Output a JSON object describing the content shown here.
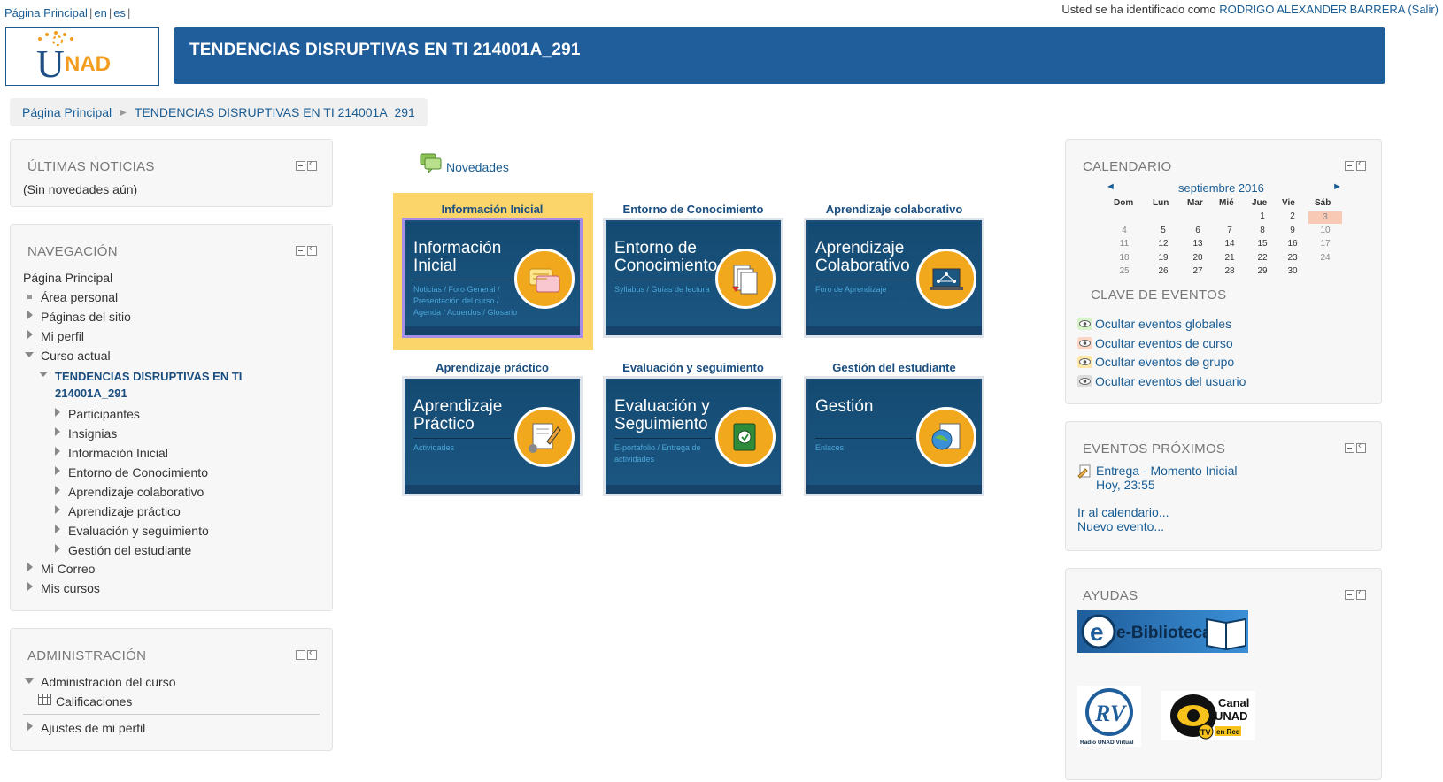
{
  "top_nav": {
    "home": "Página Principal",
    "lang_en": "en",
    "lang_es": "es"
  },
  "login": {
    "prefix": "Usted se ha identificado como",
    "user": "RODRIGO ALEXANDER BARRERA",
    "logout": "(Salir)"
  },
  "logo": {
    "text_u": "U",
    "text_nad": "NAD"
  },
  "header": {
    "title": "TENDENCIAS DISRUPTIVAS EN TI 214001A_291"
  },
  "breadcrumb": {
    "home": "Página Principal",
    "course": "TENDENCIAS DISRUPTIVAS EN TI 214001A_291"
  },
  "news_block": {
    "title": "ÚLTIMAS NOTICIAS",
    "empty": "(Sin novedades aún)"
  },
  "nav_block": {
    "title": "NAVEGACIÓN",
    "home": "Página Principal",
    "personal": "Área personal",
    "site_pages": "Páginas del sitio",
    "profile": "Mi perfil",
    "current_course": "Curso actual",
    "course_line1": "TENDENCIAS DISRUPTIVAS EN TI",
    "course_line2": "214001A_291",
    "course_items": [
      "Participantes",
      "Insignias",
      "Información Inicial",
      "Entorno de Conocimiento",
      "Aprendizaje colaborativo",
      "Aprendizaje práctico",
      "Evaluación y seguimiento",
      "Gestión del estudiante"
    ],
    "mail": "Mi Correo",
    "my_courses": "Mis cursos"
  },
  "admin_block": {
    "title": "ADMINISTRACIÓN",
    "course_admin": "Administración del curso",
    "grades": "Calificaciones",
    "profile_settings": "Ajustes de mi perfil"
  },
  "main": {
    "news_link": "Novedades",
    "sections": [
      {
        "heading": "Información Inicial",
        "title1": "Información",
        "title2": "Inicial",
        "sub": "Noticias / Foro General / Presentación del curso / Agenda / Acuerdos / Glosario",
        "icon": "speech-bubble-icon"
      },
      {
        "heading": "Entorno de Conocimiento",
        "title1": "Entorno de",
        "title2": "Conocimiento",
        "sub": "Syllabus / Guías de lectura",
        "icon": "documents-icon"
      },
      {
        "heading": "Aprendizaje colaborativo",
        "title1": "Aprendizaje",
        "title2": "Colaborativo",
        "sub": "Foro de Aprendizaje",
        "icon": "laptop-network-icon"
      },
      {
        "heading": "Aprendizaje práctico",
        "title1": "Aprendizaje",
        "title2": "Práctico",
        "sub": "Actividades",
        "icon": "pencil-document-icon"
      },
      {
        "heading": "Evaluación y seguimiento",
        "title1": "Evaluación y",
        "title2": "Seguimiento",
        "sub": "E-portafolio / Entrega de actividades",
        "icon": "notebook-icon"
      },
      {
        "heading": "Gestión del estudiante",
        "title1": "Gestión",
        "title2": "",
        "sub": "Enlaces",
        "icon": "globe-document-icon"
      }
    ]
  },
  "calendar": {
    "title": "CALENDARIO",
    "month": "septiembre 2016",
    "prev": "◄",
    "next": "►",
    "days": [
      "Dom",
      "Lun",
      "Mar",
      "Mié",
      "Jue",
      "Vie",
      "Sáb"
    ],
    "weeks": [
      [
        "",
        "",
        "",
        "",
        "1",
        "2",
        "3"
      ],
      [
        "4",
        "5",
        "6",
        "7",
        "8",
        "9",
        "10"
      ],
      [
        "11",
        "12",
        "13",
        "14",
        "15",
        "16",
        "17"
      ],
      [
        "18",
        "19",
        "20",
        "21",
        "22",
        "23",
        "24"
      ],
      [
        "25",
        "26",
        "27",
        "28",
        "29",
        "30",
        ""
      ]
    ],
    "today": "3",
    "key_title": "CLAVE DE EVENTOS",
    "key_items": [
      {
        "label": "Ocultar eventos globales",
        "color": "#d5f2c8"
      },
      {
        "label": "Ocultar eventos de curso",
        "color": "#fdd6c6"
      },
      {
        "label": "Ocultar eventos de grupo",
        "color": "#fde6a8"
      },
      {
        "label": "Ocultar eventos del usuario",
        "color": "#dcdcdc"
      }
    ]
  },
  "upcoming": {
    "title": "EVENTOS PRÓXIMOS",
    "event": "Entrega - Momento Inicial",
    "time": "Hoy, 23:55",
    "go_calendar": "Ir al calendario...",
    "new_event": "Nuevo evento..."
  },
  "help": {
    "title": "AYUDAS",
    "ebiblioteca": "e-Biblioteca",
    "radio": "Radio UNAD Virtual",
    "canal_line1": "Canal",
    "canal_line2": "UNAD",
    "canal_tv": "TV",
    "canal_red": "en Red"
  }
}
